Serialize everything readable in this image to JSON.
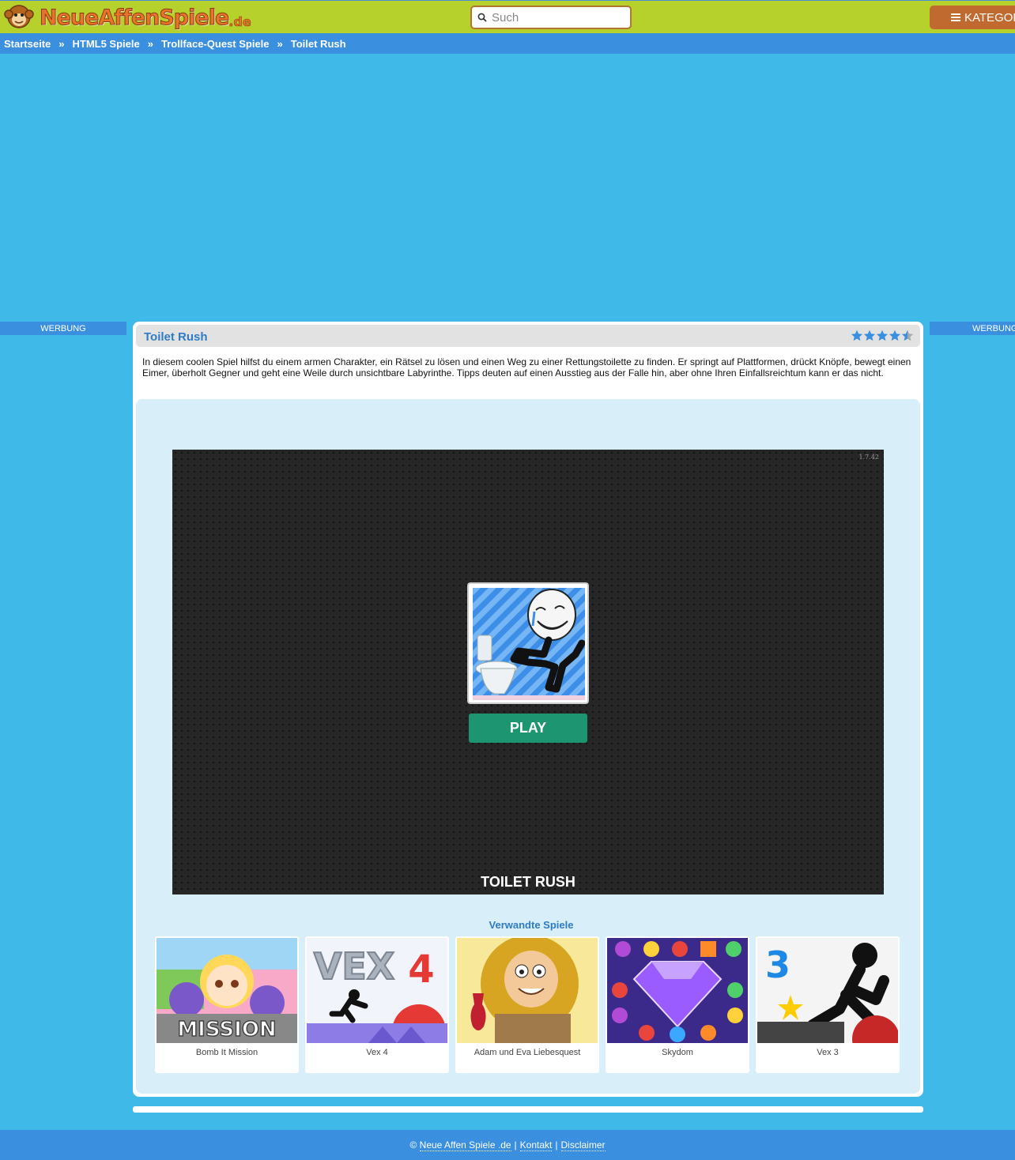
{
  "header": {
    "logo_text": "NeueAffenSpiele",
    "logo_tld": ".de",
    "search_placeholder": "Such",
    "categories_label": "KATEGORIEN"
  },
  "breadcrumb": [
    {
      "label": "Startseite"
    },
    {
      "label": "HTML5 Spiele"
    },
    {
      "label": "Trollface-Quest Spiele"
    },
    {
      "label": "Toilet Rush"
    }
  ],
  "breadcrumb_separator": "»",
  "ads": {
    "left_label": "WERBUNG",
    "right_label": "WERBUNG"
  },
  "game": {
    "title": "Toilet Rush",
    "rating": 4.5,
    "rating_max": 5,
    "description": "In diesem coolen Spiel hilfst du einem armen Charakter, ein Rätsel zu lösen und einen Weg zu einer Rettungstoilette zu finden. Er springt auf Plattformen, drückt Knöpfe, bewegt einen Eimer, überholt Gegner und geht eine Weile durch unsichtbare Labyrinthe. Tipps deuten auf einen Ausstieg aus der Falle hin, aber ohne Ihren Einfallsreichtum kann er das nicht.",
    "version": "1.7.42",
    "play_label": "PLAY",
    "splash_name": "TOILET RUSH"
  },
  "related": {
    "heading": "Verwandte Spiele",
    "items": [
      {
        "name": "Bomb It Mission",
        "thumb_text": "MISSION"
      },
      {
        "name": "Vex 4",
        "thumb_text": "VEX",
        "thumb_number": "4"
      },
      {
        "name": "Adam und Eva Liebesquest"
      },
      {
        "name": "Skydom"
      },
      {
        "name": "Vex 3",
        "thumb_number": "3"
      }
    ]
  },
  "footer": {
    "copyright": "©",
    "site_link": "Neue Affen Spiele .de",
    "contact_link": "Kontakt",
    "disclaimer_link": "Disclaimer",
    "separator": "|"
  },
  "colors": {
    "header_bg": "#b6d12b",
    "nav_bg": "#3a8fdf",
    "page_bg": "#3fb9e8",
    "play_button": "#1d9571",
    "title_blue": "#2e7cc4",
    "star_blue": "#3a8fdf"
  }
}
